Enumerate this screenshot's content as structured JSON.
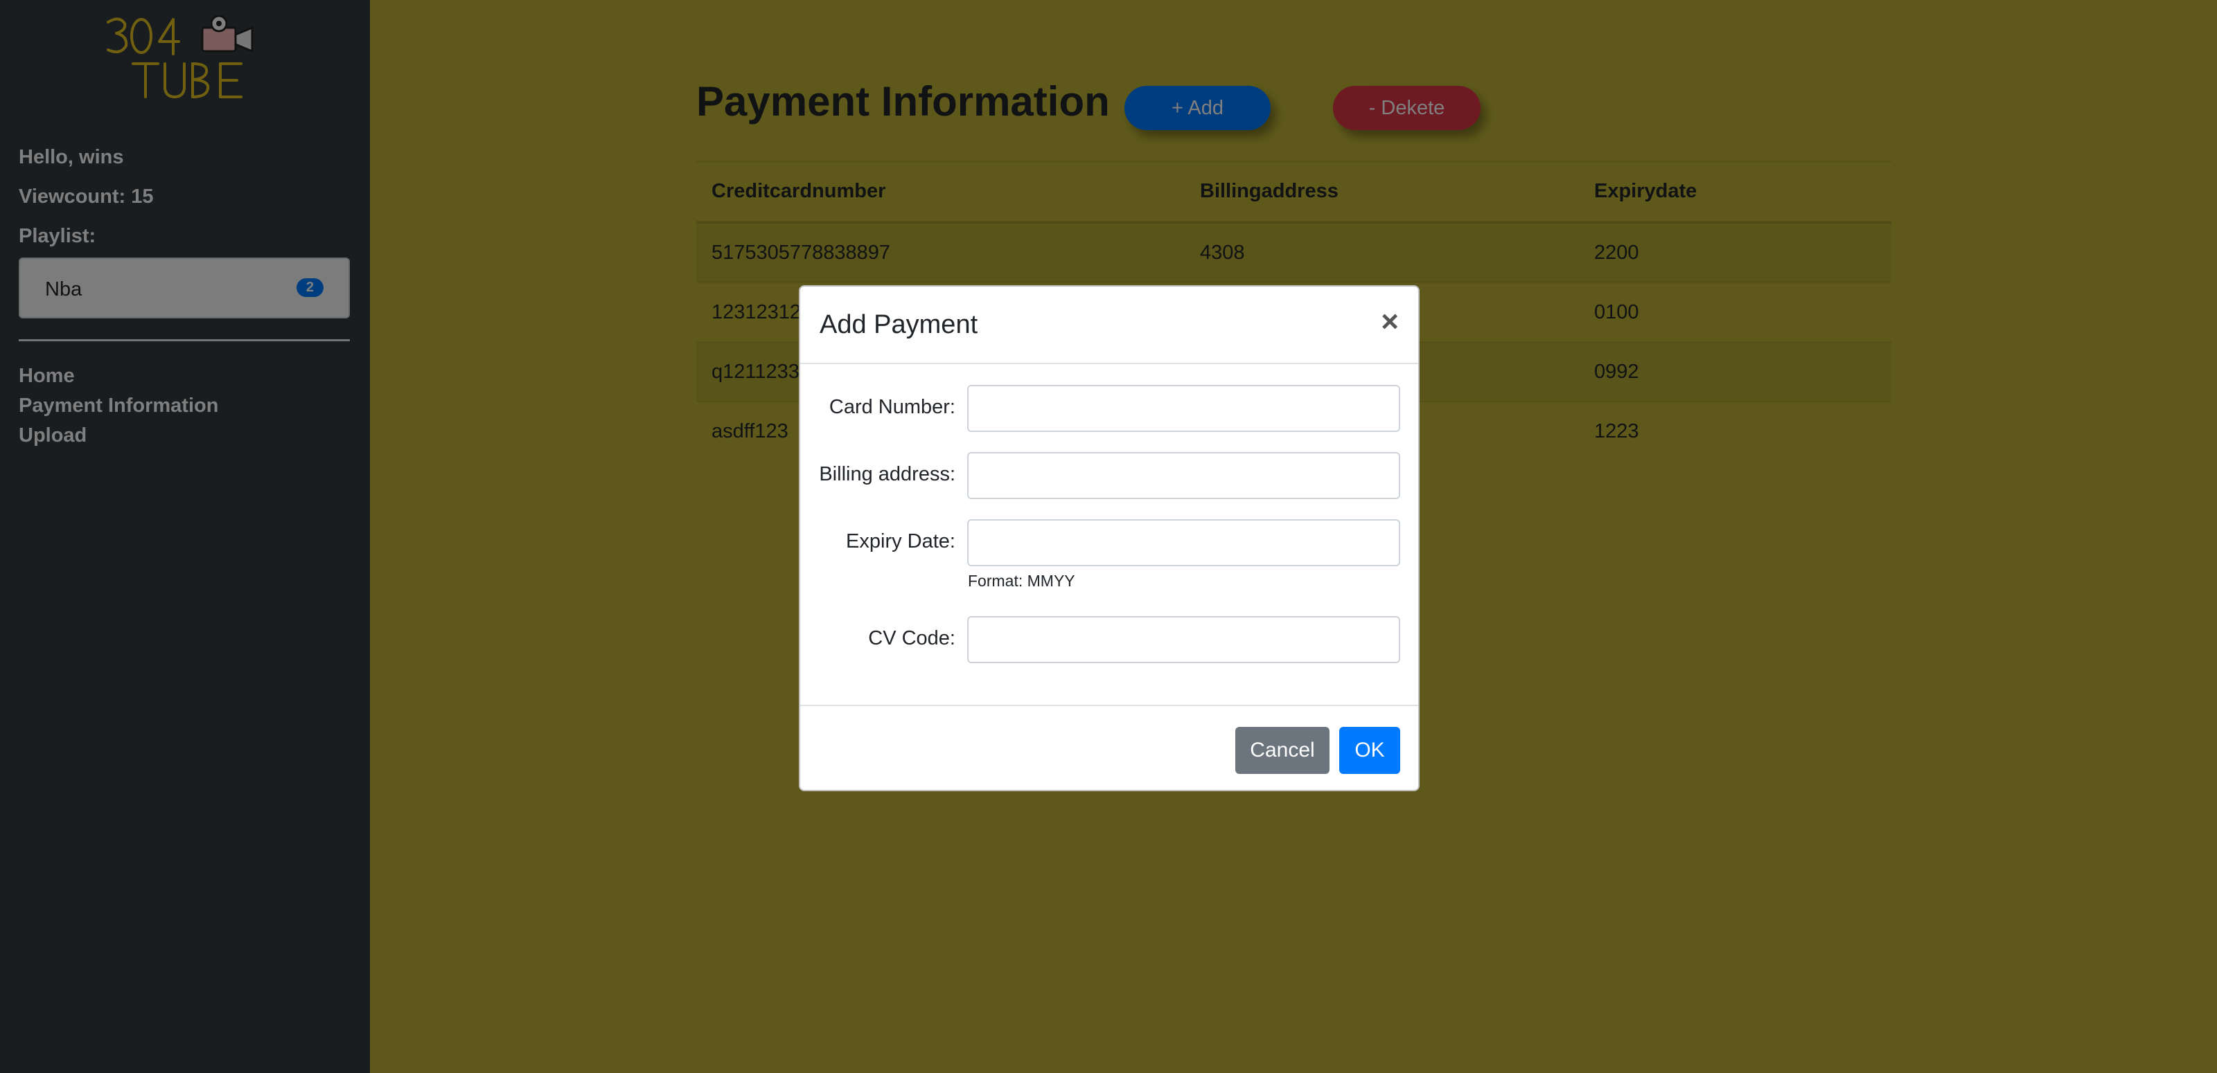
{
  "sidebar": {
    "logo_text": "304 TUBE",
    "greeting": "Hello, wins",
    "viewcount": "Viewcount: 15",
    "playlist_label": "Playlist:",
    "playlist_items": [
      {
        "label": "Nba",
        "badge": "2"
      }
    ],
    "nav": [
      "Home",
      "Payment Information",
      "Upload"
    ]
  },
  "main": {
    "title": "Payment Information",
    "add_button": "+ Add",
    "delete_button": "- Dekete",
    "columns": [
      "Creditcardnumber",
      "Billingaddress",
      "Expirydate"
    ],
    "rows": [
      [
        "5175305778838897",
        "4308",
        "2200"
      ],
      [
        "12312312",
        "",
        "0100"
      ],
      [
        "q1211233",
        "",
        "0992"
      ],
      [
        "asdff123",
        "",
        "1223"
      ]
    ]
  },
  "modal": {
    "title": "Add Payment",
    "close": "×",
    "fields": [
      {
        "label": "Card Number:",
        "value": ""
      },
      {
        "label": "Billing address:",
        "value": ""
      },
      {
        "label": "Expiry Date:",
        "value": ""
      },
      {
        "label": "CV Code:",
        "value": ""
      }
    ],
    "expiry_hint": "Format: MMYY",
    "cancel": "Cancel",
    "ok": "OK"
  },
  "colors": {
    "background": "#bdb235",
    "sidebar": "#343a40",
    "primary": "#007bff",
    "danger": "#dc3545",
    "secondary": "#6c757d"
  }
}
